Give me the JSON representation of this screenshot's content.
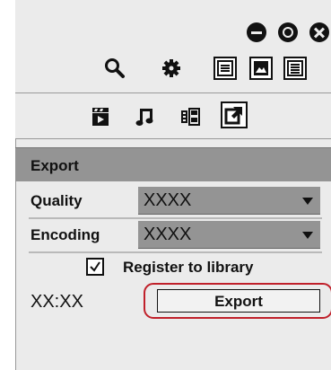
{
  "window_controls": [
    {
      "name": "minimize"
    },
    {
      "name": "maximize"
    },
    {
      "name": "close"
    }
  ],
  "toolbar": {
    "icons": [
      "search-icon",
      "settings-gear-icon",
      "list-view-icon",
      "image-view-icon",
      "detail-list-icon"
    ]
  },
  "tabs": {
    "icons": [
      "clip-icon",
      "music-note-icon",
      "film-effect-icon",
      "export-icon"
    ],
    "selected": "export-icon"
  },
  "export_panel": {
    "title": "Export",
    "quality": {
      "label": "Quality",
      "value": "XXXX"
    },
    "encoding": {
      "label": "Encoding",
      "value": "XXXX"
    },
    "register": {
      "label": "Register to library",
      "checked": true
    },
    "time": "XX:XX",
    "export_button": "Export",
    "highlight_color": "#c0202a"
  }
}
